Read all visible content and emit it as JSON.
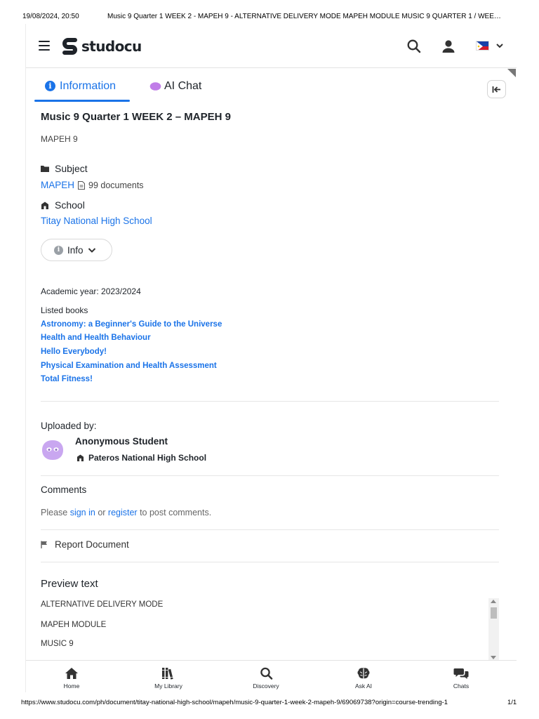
{
  "print_header": {
    "date": "19/08/2024, 20:50",
    "title": "Music 9 Quarter 1 WEEK 2 - MAPEH 9 - ALTERNATIVE DELIVERY MODE MAPEH MODULE MUSIC 9 QUARTER 1 / WEE…"
  },
  "print_footer": {
    "url": "https://www.studocu.com/ph/document/titay-national-high-school/mapeh/music-9-quarter-1-week-2-mapeh-9/69069738?origin=course-trending-1",
    "page": "1/1"
  },
  "header": {
    "logo_text": "studocu",
    "icons": [
      "menu-icon",
      "search-icon",
      "user-icon",
      "flag-icon",
      "chevron-down-icon"
    ]
  },
  "tabs": [
    {
      "label": "Information",
      "active": true
    },
    {
      "label": "AI Chat",
      "active": false
    }
  ],
  "document": {
    "title": "Music 9 Quarter 1 WEEK 2 – MAPEH 9",
    "subtitle": "MAPEH 9",
    "subject_label": "Subject",
    "subject_value": "MAPEH",
    "subject_doc_count": "99 documents",
    "school_label": "School",
    "school_value": "Titay National High School",
    "info_button": "Info",
    "academic_year": "Academic year: 2023/2024",
    "listed_books_label": "Listed books",
    "books": [
      "Astronomy: a Beginner's Guide to the Universe",
      "Health and Health Behaviour",
      "Hello Everybody!",
      "Physical Examination and Health Assessment",
      "Total Fitness!"
    ]
  },
  "uploader": {
    "label": "Uploaded by:",
    "name": "Anonymous Student",
    "school": "Pateros National High School"
  },
  "comments": {
    "heading": "Comments",
    "prefix": "Please ",
    "sign_in": "sign in",
    "middle": " or ",
    "register": "register",
    "suffix": " to post comments."
  },
  "report": {
    "label": "Report Document"
  },
  "preview": {
    "heading": "Preview text",
    "lines": [
      "ALTERNATIVE DELIVERY MODE",
      "MAPEH MODULE",
      "MUSIC 9"
    ]
  },
  "bottom_nav": [
    {
      "label": "Home",
      "icon": "home-icon"
    },
    {
      "label": "My Library",
      "icon": "library-icon"
    },
    {
      "label": "Discovery",
      "icon": "search-icon"
    },
    {
      "label": "Ask AI",
      "icon": "brain-icon"
    },
    {
      "label": "Chats",
      "icon": "chat-icon"
    }
  ],
  "colors": {
    "accent": "#1a73e8",
    "text": "#1e2329",
    "avatar": "#c9a7f0"
  }
}
